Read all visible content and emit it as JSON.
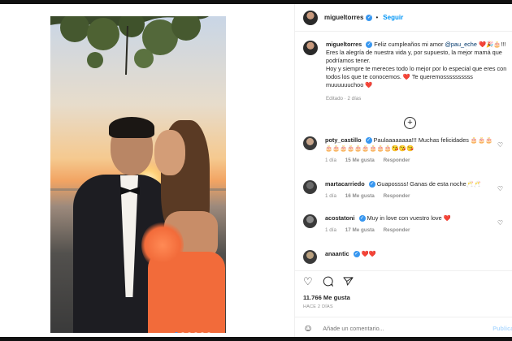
{
  "post": {
    "author": "migueltorres",
    "follow_label": "Seguir",
    "more_label": "•",
    "caption_user": "migueltorres",
    "caption_part1": "Feliz cumpleaños mi amor ",
    "caption_mention": "@pau_eche",
    "caption_part2": " ❤️🎉🎂!!! Eres la alegría de nuestra vida y, por supuesto, la mejor mamá que podríamos tener.",
    "caption_part3": "Hoy y siempre te mereces todo lo mejor por lo especial que eres con todos los que te conocemos. ❤️ Te queremossssssssss muuuuuuchoo ❤️",
    "edited_label": "Editado · 2 días",
    "add_more_icon": "plus-circle-icon"
  },
  "comments": [
    {
      "user": "poty_castillo",
      "text": "Paulaaaaaaaa!!! Muchas felicidades 🎂🎂🎂🎂🎂🎂🎂🎂🎂🎂🎂🎂😘😘😘",
      "time": "1 día",
      "likes": "15 Me gusta",
      "reply": "Responder",
      "avatar_color": "#c7a58b"
    },
    {
      "user": "martacarriedo",
      "text": "Guapossss! Ganas de esta noche🥂🥂",
      "time": "1 día",
      "likes": "16 Me gusta",
      "reply": "Responder",
      "avatar_color": "#6b6b6b"
    },
    {
      "user": "acostatoni",
      "text": "Muy in love con vuestro love ❤️",
      "time": "1 día",
      "likes": "17 Me gusta",
      "reply": "Responder",
      "avatar_color": "#8a8a8a"
    },
    {
      "user": "anaantic",
      "text": "❤️❤️",
      "time": "",
      "likes": "",
      "reply": "",
      "avatar_color": "#b9a07f"
    }
  ],
  "actions": {
    "likes_count": "11.766 Me gusta",
    "time_ago": "HACE 2 DÍAS",
    "comment_placeholder": "Añade un comentario...",
    "publish_label": "Publicar",
    "icons": [
      "heart-icon",
      "comment-icon",
      "share-icon",
      "emoji-icon"
    ]
  },
  "carousel": {
    "count": 6,
    "active_index": 0
  },
  "colors": {
    "accent": "#0095f6",
    "verified": "#3897f0",
    "muted": "#8e8e8e"
  }
}
